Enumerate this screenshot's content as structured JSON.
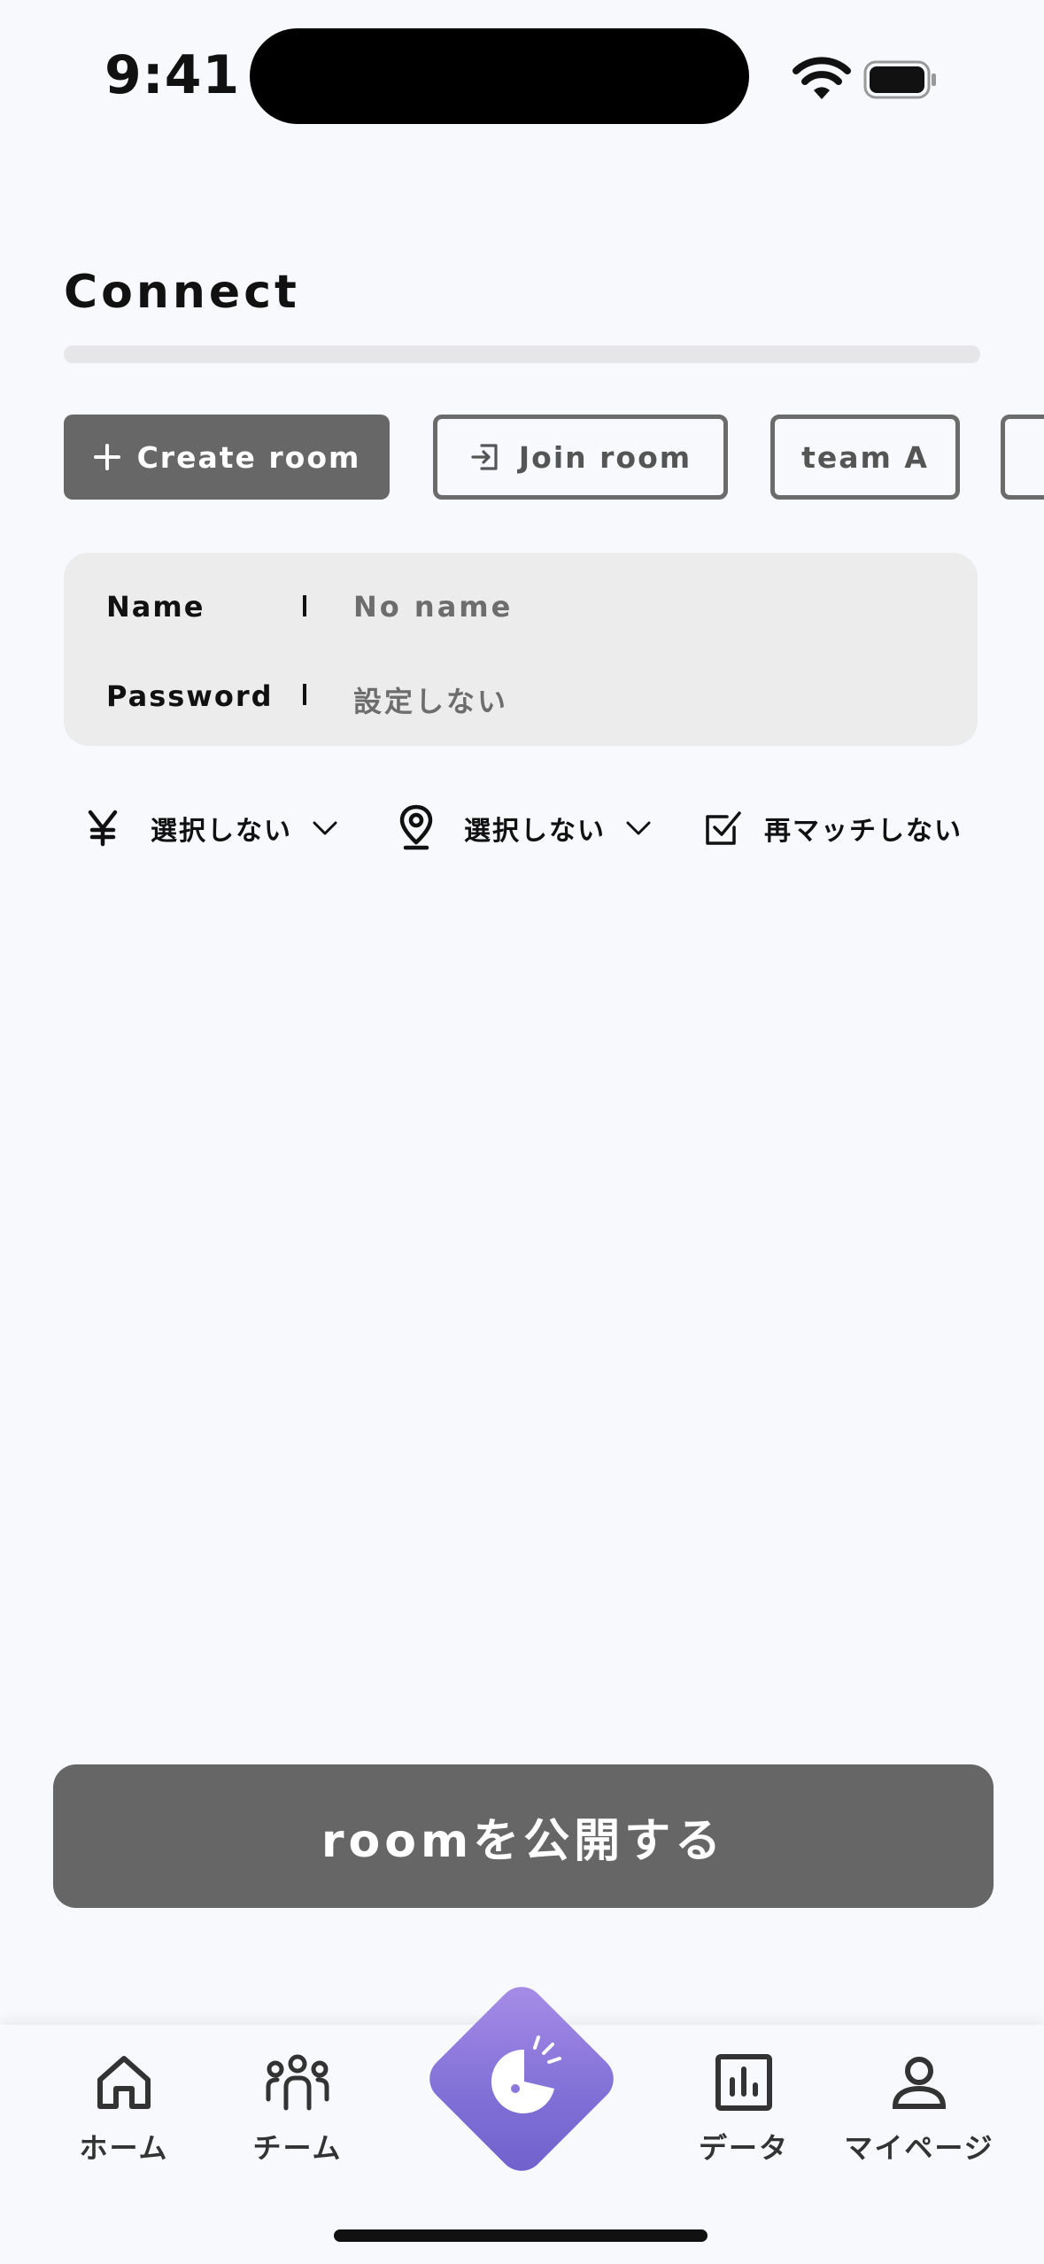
{
  "status_bar": {
    "time": "9:41"
  },
  "page": {
    "title": "Connect",
    "progress": 0
  },
  "tabs": [
    {
      "label": "Create room",
      "icon": "plus-icon"
    },
    {
      "label": "Join room",
      "icon": "login-icon"
    },
    {
      "label": "team A"
    },
    {
      "label": ""
    }
  ],
  "room_info": {
    "name_label": "Name",
    "name_value": "No name",
    "password_label": "Password",
    "password_value": "設定しない"
  },
  "filters": {
    "fee_label": "選択しない",
    "location_label": "選択しない",
    "rematch_label": "再マッチしない"
  },
  "publish_button": {
    "label": "roomを公開する"
  },
  "bottom_nav": {
    "home": "ホーム",
    "team": "チーム",
    "data": "データ",
    "mypage": "マイページ"
  },
  "colors": {
    "background": "#f7f9fd",
    "primary_button": "#676767",
    "card": "#ececec",
    "accent_gradient_start": "#a98ee8",
    "accent_gradient_end": "#6f5fcb"
  }
}
